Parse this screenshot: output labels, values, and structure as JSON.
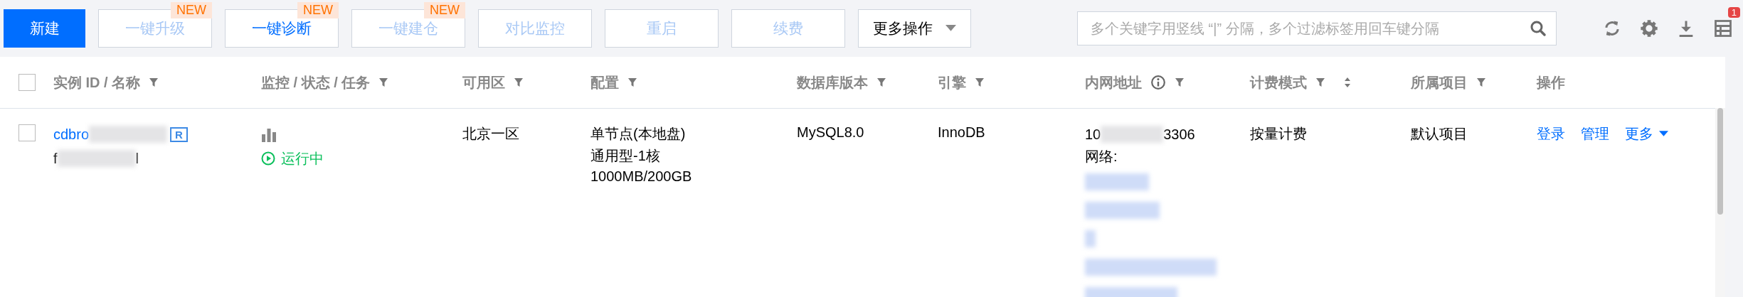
{
  "toolbar": {
    "buttons": [
      {
        "label": "新建",
        "kind": "primary",
        "disabled": false
      },
      {
        "label": "一键升级",
        "kind": "plain",
        "disabled": true,
        "badge": "NEW"
      },
      {
        "label": "一键诊断",
        "kind": "plain",
        "disabled": false,
        "badge": "NEW"
      },
      {
        "label": "一键建仓",
        "kind": "plain",
        "disabled": true,
        "badge": "NEW"
      },
      {
        "label": "对比监控",
        "kind": "plain",
        "disabled": true
      },
      {
        "label": "重启",
        "kind": "plain",
        "disabled": true
      },
      {
        "label": "续费",
        "kind": "plain",
        "disabled": true
      },
      {
        "label": "更多操作",
        "kind": "dropdown",
        "disabled": false
      }
    ],
    "search": {
      "placeholder": "多个关键字用竖线 “|” 分隔，多个过滤标签用回车键分隔"
    },
    "notification_count": "1"
  },
  "table": {
    "select_all": {
      "checked": false
    },
    "columns": [
      {
        "label": "实例 ID / 名称",
        "filter": true
      },
      {
        "label": "监控 / 状态 / 任务",
        "filter": true
      },
      {
        "label": "可用区",
        "filter": true
      },
      {
        "label": "配置",
        "filter": true
      },
      {
        "label": "数据库版本",
        "filter": true
      },
      {
        "label": "引擎",
        "filter": true
      },
      {
        "label": "内网地址",
        "filter": true,
        "info": true
      },
      {
        "label": "计费模式",
        "filter": true,
        "sort": true
      },
      {
        "label": "所属项目",
        "filter": true
      },
      {
        "label": "操作",
        "filter": false
      }
    ],
    "rows": [
      {
        "checked": false,
        "id_prefix": "cdbro",
        "id_badge": "R",
        "name_start": "f",
        "name_end": "l",
        "status": "运行中",
        "zone": "北京一区",
        "config": [
          "单节点(本地盘)",
          "通用型-1核",
          "1000MB/200GB"
        ],
        "db_version": "MySQL8.0",
        "engine": "InnoDB",
        "ip_start": "10",
        "ip_end": "3306",
        "network_label": "网络:",
        "billing": "按量计费",
        "project": "默认项目",
        "actions": [
          {
            "label": "登录",
            "dropdown": false
          },
          {
            "label": "管理",
            "dropdown": false
          },
          {
            "label": "更多",
            "dropdown": true
          }
        ]
      }
    ]
  }
}
